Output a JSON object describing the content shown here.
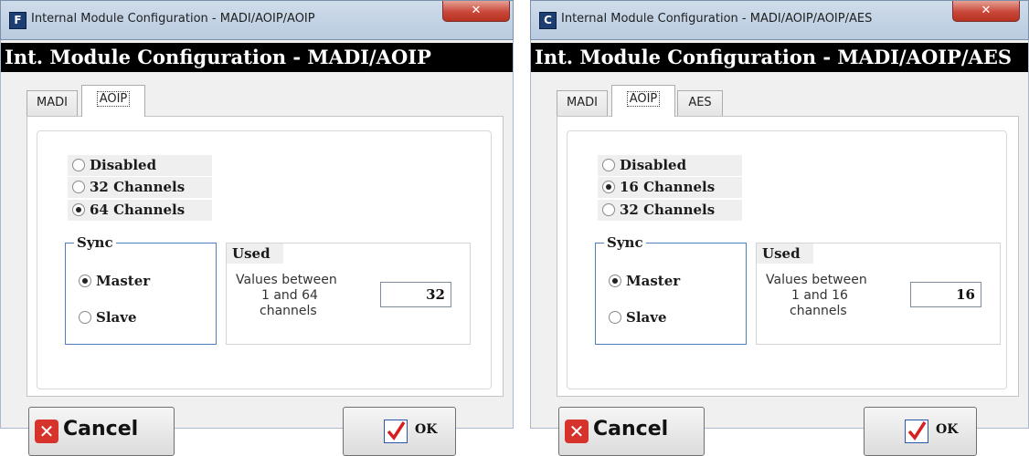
{
  "windows": [
    {
      "app_icon": "F",
      "title": "Internal Module Configuration - MADI/AOIP/AOIP",
      "header": "Int. Module Configuration - MADI/AOIP",
      "tabs": [
        "MADI",
        "AOIP"
      ],
      "active_tab": "AOIP",
      "channel_options": [
        {
          "label": "Disabled",
          "selected": false
        },
        {
          "label": "32 Channels",
          "selected": false
        },
        {
          "label": "64 Channels",
          "selected": true
        }
      ],
      "sync": {
        "legend": "Sync",
        "master": "Master",
        "slave": "Slave",
        "selected": "Master"
      },
      "used": {
        "header": "Used",
        "desc_line1": "Values between",
        "desc_line2": "1 and 64",
        "desc_line3": "channels",
        "value": "32"
      },
      "cancel_label": "Cancel",
      "ok_label": "OK"
    },
    {
      "app_icon": "C",
      "title": "Internal Module Configuration - MADI/AOIP/AOIP/AES",
      "header": "Int. Module Configuration - MADI/AOIP/AES",
      "tabs": [
        "MADI",
        "AOIP",
        "AES"
      ],
      "active_tab": "AOIP",
      "channel_options": [
        {
          "label": "Disabled",
          "selected": false
        },
        {
          "label": "16 Channels",
          "selected": true
        },
        {
          "label": "32 Channels",
          "selected": false
        }
      ],
      "sync": {
        "legend": "Sync",
        "master": "Master",
        "slave": "Slave",
        "selected": "Master"
      },
      "used": {
        "header": "Used",
        "desc_line1": "Values between",
        "desc_line2": "1 and 16",
        "desc_line3": "channels",
        "value": "16"
      },
      "cancel_label": "Cancel",
      "ok_label": "OK"
    }
  ],
  "icons": {
    "close": "close-x-icon",
    "cancel": "red-x-icon",
    "ok": "blue-checkmark-icon"
  },
  "colors": {
    "close_red": "#c9483a",
    "cancel_red": "#d7332d",
    "ok_blue": "#2b56a8",
    "check_red": "#d62020",
    "header_bg": "#000000"
  }
}
